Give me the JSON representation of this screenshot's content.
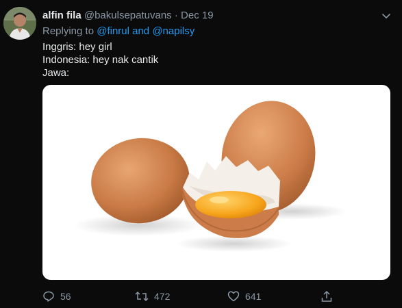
{
  "tweet": {
    "author_name": "alfin fila",
    "author_handle": "@bakulsepatuvans",
    "separator": "·",
    "date": "Dec 19",
    "replying_label": "Replying to",
    "replying_to": "@finrul and @napilsy",
    "lines": [
      "Inggris: hey girl",
      "Indonesia: hey nak cantik",
      "Jawa:"
    ],
    "media_icon": "eggs-photo",
    "actions": {
      "reply_count": "56",
      "retweet_count": "472",
      "like_count": "641"
    }
  },
  "colors": {
    "background": "#0b0b0c",
    "link": "#1d9bf0",
    "muted": "#8b98a5"
  }
}
